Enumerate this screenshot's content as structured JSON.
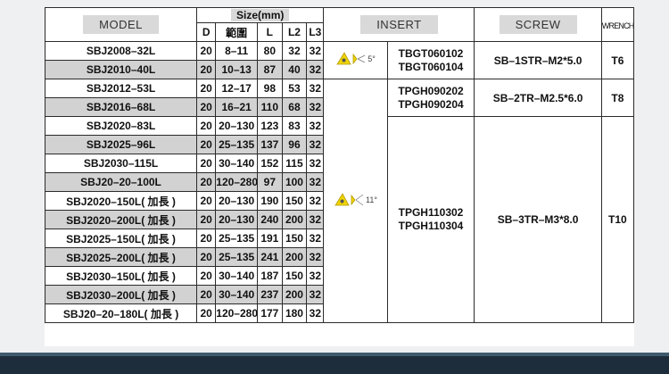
{
  "headers": {
    "model": "MODEL",
    "size": "Size(mm)",
    "d": "D",
    "range": "範圍",
    "l": "L",
    "l2": "L2",
    "l3": "L3",
    "insert": "INSERT",
    "screw": "SCREW",
    "wrench": "WRENCH"
  },
  "rows": [
    {
      "model": "SBJ2008–32L",
      "d": "20",
      "range": "8–11",
      "l": "80",
      "l2": "32",
      "l3": "32",
      "shade": false
    },
    {
      "model": "SBJ2010–40L",
      "d": "20",
      "range": "10–13",
      "l": "87",
      "l2": "40",
      "l3": "32",
      "shade": true
    },
    {
      "model": "SBJ2012–53L",
      "d": "20",
      "range": "12–17",
      "l": "98",
      "l2": "53",
      "l3": "32",
      "shade": false
    },
    {
      "model": "SBJ2016–68L",
      "d": "20",
      "range": "16–21",
      "l": "110",
      "l2": "68",
      "l3": "32",
      "shade": true
    },
    {
      "model": "SBJ2020–83L",
      "d": "20",
      "range": "20–130",
      "l": "123",
      "l2": "83",
      "l3": "32",
      "shade": false
    },
    {
      "model": "SBJ2025–96L",
      "d": "20",
      "range": "25–135",
      "l": "137",
      "l2": "96",
      "l3": "32",
      "shade": true
    },
    {
      "model": "SBJ2030–115L",
      "d": "20",
      "range": "30–140",
      "l": "152",
      "l2": "115",
      "l3": "32",
      "shade": false
    },
    {
      "model": "SBJ20–20–100L",
      "d": "20",
      "range": "120–280",
      "l": "97",
      "l2": "100",
      "l3": "32",
      "shade": true
    },
    {
      "model": "SBJ2020–150L( 加長 )",
      "d": "20",
      "range": "20–130",
      "l": "190",
      "l2": "150",
      "l3": "32",
      "shade": false
    },
    {
      "model": "SBJ2020–200L( 加長 )",
      "d": "20",
      "range": "20–130",
      "l": "240",
      "l2": "200",
      "l3": "32",
      "shade": true
    },
    {
      "model": "SBJ2025–150L( 加長 )",
      "d": "20",
      "range": "25–135",
      "l": "191",
      "l2": "150",
      "l3": "32",
      "shade": false
    },
    {
      "model": "SBJ2025–200L( 加長 )",
      "d": "20",
      "range": "25–135",
      "l": "241",
      "l2": "200",
      "l3": "32",
      "shade": true
    },
    {
      "model": "SBJ2030–150L( 加長 )",
      "d": "20",
      "range": "30–140",
      "l": "187",
      "l2": "150",
      "l3": "32",
      "shade": false
    },
    {
      "model": "SBJ2030–200L( 加長 )",
      "d": "20",
      "range": "30–140",
      "l": "237",
      "l2": "200",
      "l3": "32",
      "shade": true
    },
    {
      "model": "SBJ20–20–180L( 加長 )",
      "d": "20",
      "range": "120–280",
      "l": "177",
      "l2": "180",
      "l3": "32",
      "shade": false
    }
  ],
  "groups": {
    "g1": {
      "angle": "5°",
      "insert_1": "TBGT060102",
      "insert_2": "TBGT060104",
      "screw": "SB–1STR–M2*5.0",
      "wrench": "T6"
    },
    "g2": {
      "insert_1": "TPGH090202",
      "insert_2": "TPGH090204",
      "screw": "SB–2TR–M2.5*6.0",
      "wrench": "T8"
    },
    "g3": {
      "angle": "11°",
      "insert_1": "TPGH110302",
      "insert_2": "TPGH110304",
      "screw": "SB–3TR–M3*8.0",
      "wrench": "T10"
    }
  },
  "colors": {
    "shade": "#d2d2d2",
    "insert_yellow": "#f0d400",
    "footer": "#1e2d3b"
  }
}
